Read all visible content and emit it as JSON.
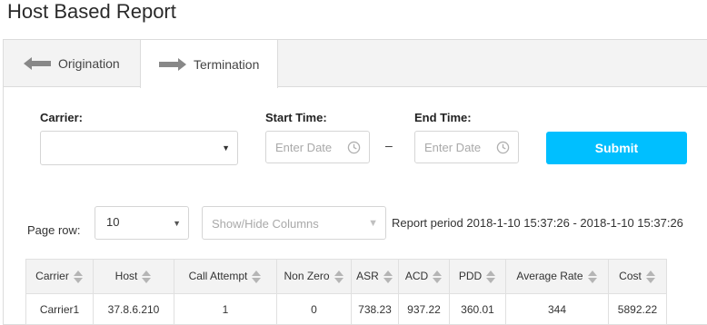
{
  "page": {
    "title": "Host Based Report"
  },
  "tabs": [
    {
      "label": "Origination",
      "icon": "arrow-left-icon"
    },
    {
      "label": "Termination",
      "icon": "arrow-right-icon"
    }
  ],
  "filters": {
    "carrier_label": "Carrier:",
    "carrier_value": "",
    "start_label": "Start Time:",
    "start_placeholder": "Enter Date",
    "end_label": "End Time:",
    "end_placeholder": "Enter Date",
    "range_separator": "–",
    "submit_label": "Submit"
  },
  "controls": {
    "page_row_label": "Page row:",
    "page_row_value": "10",
    "columns_placeholder": "Show/Hide Columns",
    "report_period": "Report period 2018-1-10 15:37:26 - 2018-1-10 15:37:26"
  },
  "table": {
    "columns": [
      "Carrier",
      "Host",
      "Call Attempt",
      "Non Zero",
      "ASR",
      "ACD",
      "PDD",
      "Average Rate",
      "Cost"
    ],
    "rows": [
      [
        "Carrier1",
        "37.8.6.210",
        "1",
        "0",
        "738.23",
        "937.22",
        "360.01",
        "344",
        "5892.22"
      ]
    ]
  },
  "colors": {
    "accent": "#00bfff",
    "tabbar_bg": "#f3f3f3",
    "header_bg": "#f3f3f3"
  }
}
